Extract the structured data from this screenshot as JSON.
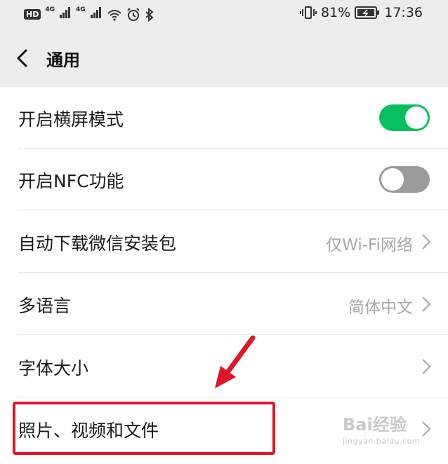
{
  "status_bar": {
    "hd": "HD",
    "network_1": "4G",
    "network_2": "4G",
    "battery_percent": "81%",
    "time": "17:36"
  },
  "nav": {
    "title": "通用"
  },
  "settings": [
    {
      "label": "开启横屏模式",
      "type": "toggle",
      "state": "on"
    },
    {
      "label": "开启NFC功能",
      "type": "toggle",
      "state": "off"
    },
    {
      "label": "自动下载微信安装包",
      "type": "link",
      "value": "仅Wi-Fi网络"
    },
    {
      "label": "多语言",
      "type": "link",
      "value": "简体中文"
    },
    {
      "label": "字体大小",
      "type": "link",
      "value": ""
    },
    {
      "label": "照片、视频和文件",
      "type": "link",
      "value": ""
    }
  ],
  "watermark": {
    "main": "Bai经验",
    "sub": "jingyan.baidu.com"
  },
  "colors": {
    "toggle_on": "#07c160",
    "toggle_off": "#9b9b9b",
    "highlight": "#e0142a",
    "background": "#ededed"
  }
}
